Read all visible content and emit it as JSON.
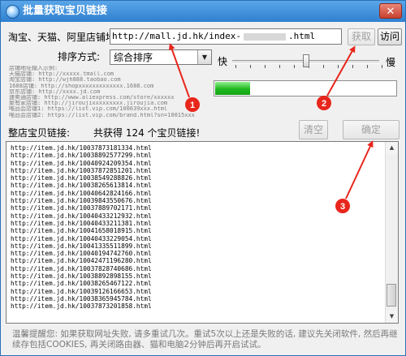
{
  "window": {
    "title": "批量获取宝贝链接",
    "close_glyph": "✕"
  },
  "url_row": {
    "label": "淘宝、天猫、阿里店铺地址:",
    "value_prefix": "http://mall.jd.hk/index-",
    "value_suffix": ".html",
    "fetch_button": "获取",
    "visit_button": "访问"
  },
  "sort_row": {
    "label": "排序方式:",
    "selected": "综合排序"
  },
  "speed": {
    "fast_label": "快",
    "slow_label": "慢",
    "level": 0.5
  },
  "progress": {
    "fraction": 0.19,
    "color": "#1fb81f"
  },
  "examples": [
    "店铺地址输入示例:",
    "天猫店铺: http://xxxxx.tmall.com",
    "淘宝店铺: http://wjh888.taobao.com",
    "1688店铺: http://shopxxxxxxxxxxxxx.1688.com",
    "京东店铺: http://xxxx.jd.com",
    "速卖通店铺: http://www.aliexpress.com/store/xxxxxx",
    "聚有家店铺: http://jiroujixxxxxxxxx.jiroujia.com",
    "唯品会店铺1: https://list.vip.com/100639xxx.html",
    "唯品会店铺2: https://list.vip.com/brand.html?sn=10015xxx"
  ],
  "list_section": {
    "label": "整店宝贝链接:",
    "count_text": "共获得 124 个宝贝链接!",
    "clear_button": "清空",
    "confirm_button": "确定",
    "links": [
      "http://item.jd.hk/10037873181334.html",
      "http://item.jd.hk/10038892577299.html",
      "http://item.jd.hk/10040924209354.html",
      "http://item.jd.hk/10037872851201.html",
      "http://item.jd.hk/10038549288826.html",
      "http://item.jd.hk/10038265613814.html",
      "http://item.jd.hk/10040642824166.html",
      "http://item.jd.hk/10039843550676.html",
      "http://item.jd.hk/10037889702171.html",
      "http://item.jd.hk/10040433212932.html",
      "http://item.jd.hk/10040433211381.html",
      "http://item.jd.hk/10041658018915.html",
      "http://item.jd.hk/10040433229054.html",
      "http://item.jd.hk/10041335511899.html",
      "http://item.jd.hk/10040194742760.html",
      "http://item.jd.hk/10042471196280.html",
      "http://item.jd.hk/10037828740686.html",
      "http://item.jd.hk/10038892898155.html",
      "http://item.jd.hk/10038265467122.html",
      "http://item.jd.hk/10039126166653.html",
      "http://item.jd.hk/10038365945784.html",
      "http://item.jd.hk/10037873201858.html"
    ]
  },
  "tip": "温馨提醒您: 如果获取网址失败, 请多重试几次。重试5次以上还是失败的话, 建议先关闭软件, 然后再继续存包括COOKIES, 再关闭路由器、猫和电脑2分钟后再开启试试。",
  "annotations": {
    "color": "#e8261c",
    "markers": [
      "1",
      "2",
      "3"
    ]
  }
}
